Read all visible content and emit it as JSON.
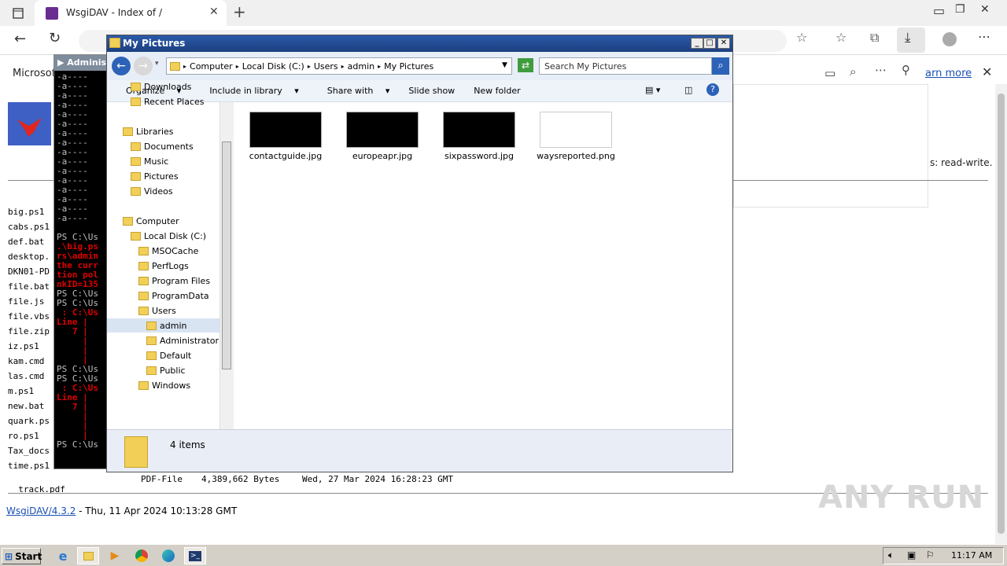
{
  "browser": {
    "tab_title": "WsgiDAV - Index of /",
    "notif_left": "Microsof",
    "learn_more": "arn more",
    "rw_text": "s: read-write."
  },
  "listing": {
    "files": [
      {
        "name": "big.ps1"
      },
      {
        "name": "cabs.ps1"
      },
      {
        "name": "def.bat"
      },
      {
        "name": "desktop."
      },
      {
        "name": "DKN01-PD"
      },
      {
        "name": "file.bat"
      },
      {
        "name": "file.js"
      },
      {
        "name": "file.vbs"
      },
      {
        "name": "file.zip"
      },
      {
        "name": "iz.ps1"
      },
      {
        "name": "kam.cmd"
      },
      {
        "name": "las.cmd"
      },
      {
        "name": "m.ps1"
      },
      {
        "name": "new.bat"
      },
      {
        "name": "quark.ps"
      },
      {
        "name": "ro.ps1"
      },
      {
        "name": "Tax_docs"
      },
      {
        "name": "time.ps1"
      }
    ],
    "last_row": {
      "name": "track.pdf",
      "type": "PDF-File",
      "size": "4,389,662 Bytes",
      "date": "Wed, 27 Mar 2024 16:28:23 GMT"
    },
    "footer_link": "WsgiDAV/4.3.2",
    "footer_text": " - Thu, 11 Apr 2024 10:13:28 GMT"
  },
  "console": {
    "title": "Adminis",
    "lines": [
      {
        "t": "-a----",
        "r": false
      },
      {
        "t": "-a----",
        "r": false
      },
      {
        "t": "-a----",
        "r": false
      },
      {
        "t": "-a----",
        "r": false
      },
      {
        "t": "-a----",
        "r": false
      },
      {
        "t": "-a----",
        "r": false
      },
      {
        "t": "-a----",
        "r": false
      },
      {
        "t": "-a----",
        "r": false
      },
      {
        "t": "-a----",
        "r": false
      },
      {
        "t": "-a----",
        "r": false
      },
      {
        "t": "-a----",
        "r": false
      },
      {
        "t": "-a----",
        "r": false
      },
      {
        "t": "-a----",
        "r": false
      },
      {
        "t": "-a----",
        "r": false
      },
      {
        "t": "-a----",
        "r": false
      },
      {
        "t": "-a----",
        "r": false
      },
      {
        "t": "",
        "r": false
      },
      {
        "t": "PS C:\\Us",
        "r": false
      },
      {
        "t": ".\\big.ps",
        "r": true
      },
      {
        "t": "rs\\admin",
        "r": true
      },
      {
        "t": "the curr",
        "r": true
      },
      {
        "t": "tion pol",
        "r": true
      },
      {
        "t": "nkID=135",
        "r": true
      },
      {
        "t": "PS C:\\Us",
        "r": false
      },
      {
        "t": "PS C:\\Us",
        "r": false
      },
      {
        "t": " : C:\\Us",
        "r": true
      },
      {
        "t": "Line |",
        "r": true
      },
      {
        "t": "   7 |",
        "r": true
      },
      {
        "t": "     | ",
        "r": true
      },
      {
        "t": "     | ",
        "r": true
      },
      {
        "t": "     | ",
        "r": true
      },
      {
        "t": "PS C:\\Us",
        "r": false
      },
      {
        "t": "PS C:\\Us",
        "r": false
      },
      {
        "t": " : C:\\Us",
        "r": true
      },
      {
        "t": "Line |",
        "r": true
      },
      {
        "t": "   7 |",
        "r": true
      },
      {
        "t": "     | ",
        "r": true
      },
      {
        "t": "     | ",
        "r": true
      },
      {
        "t": "     | ",
        "r": true
      },
      {
        "t": "PS C:\\Us",
        "r": false
      }
    ]
  },
  "explorer": {
    "title": "My Pictures",
    "breadcrumb": [
      "Computer",
      "Local Disk (C:)",
      "Users",
      "admin",
      "My Pictures"
    ],
    "search_placeholder": "Search My Pictures",
    "commands": [
      "Organize",
      "Include in library",
      "Share with",
      "Slide show",
      "New folder"
    ],
    "nav": [
      {
        "label": "Downloads",
        "indent": 1
      },
      {
        "label": "Recent Places",
        "indent": 1
      },
      {
        "label": "Libraries",
        "indent": 0
      },
      {
        "label": "Documents",
        "indent": 1
      },
      {
        "label": "Music",
        "indent": 1
      },
      {
        "label": "Pictures",
        "indent": 1
      },
      {
        "label": "Videos",
        "indent": 1
      },
      {
        "label": "Computer",
        "indent": 0
      },
      {
        "label": "Local Disk (C:)",
        "indent": 1
      },
      {
        "label": "MSOCache",
        "indent": 2
      },
      {
        "label": "PerfLogs",
        "indent": 2
      },
      {
        "label": "Program Files",
        "indent": 2
      },
      {
        "label": "ProgramData",
        "indent": 2
      },
      {
        "label": "Users",
        "indent": 2
      },
      {
        "label": "admin",
        "indent": 3
      },
      {
        "label": "Administrator",
        "indent": 3
      },
      {
        "label": "Default",
        "indent": 3
      },
      {
        "label": "Public",
        "indent": 3
      },
      {
        "label": "Windows",
        "indent": 2
      }
    ],
    "files": [
      {
        "name": "contactguide.jpg",
        "dark": true
      },
      {
        "name": "europeapr.jpg",
        "dark": true
      },
      {
        "name": "sixpassword.jpg",
        "dark": true
      },
      {
        "name": "waysreported.png",
        "dark": false
      }
    ],
    "item_count": "4 items"
  },
  "taskbar": {
    "start": "Start",
    "clock": "11:17 AM"
  },
  "watermark": "ANY RUN"
}
